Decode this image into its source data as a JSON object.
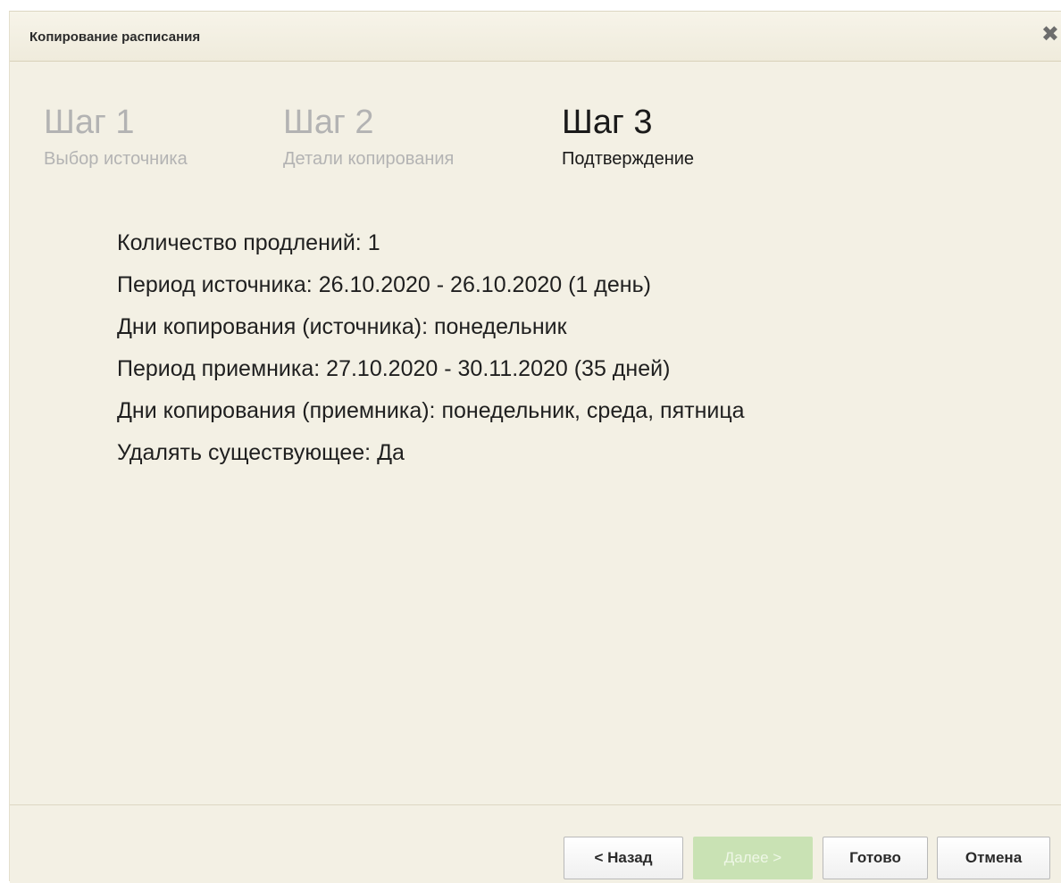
{
  "dialog": {
    "title": "Копирование расписания",
    "close_icon": "close-icon"
  },
  "steps": [
    {
      "title": "Шаг 1",
      "subtitle": "Выбор источника",
      "active": false
    },
    {
      "title": "Шаг 2",
      "subtitle": "Детали копирования",
      "active": false
    },
    {
      "title": "Шаг 3",
      "subtitle": "Подтверждение",
      "active": true
    }
  ],
  "details": [
    "Количество продлений: 1",
    "Период источника: 26.10.2020 - 26.10.2020 (1 день)",
    "Дни копирования (источника): понедельник",
    "Период приемника: 27.10.2020 - 30.11.2020 (35 дней)",
    "Дни копирования (приемника): понедельник, среда, пятница",
    "Удалять существующее: Да"
  ],
  "buttons": {
    "back": "< Назад",
    "next": "Далее >",
    "done": "Готово",
    "cancel": "Отмена"
  },
  "colors": {
    "background": "#f3f0e4",
    "inactive_step": "#b3b3b3",
    "disabled_button": "#c9e2b4"
  }
}
